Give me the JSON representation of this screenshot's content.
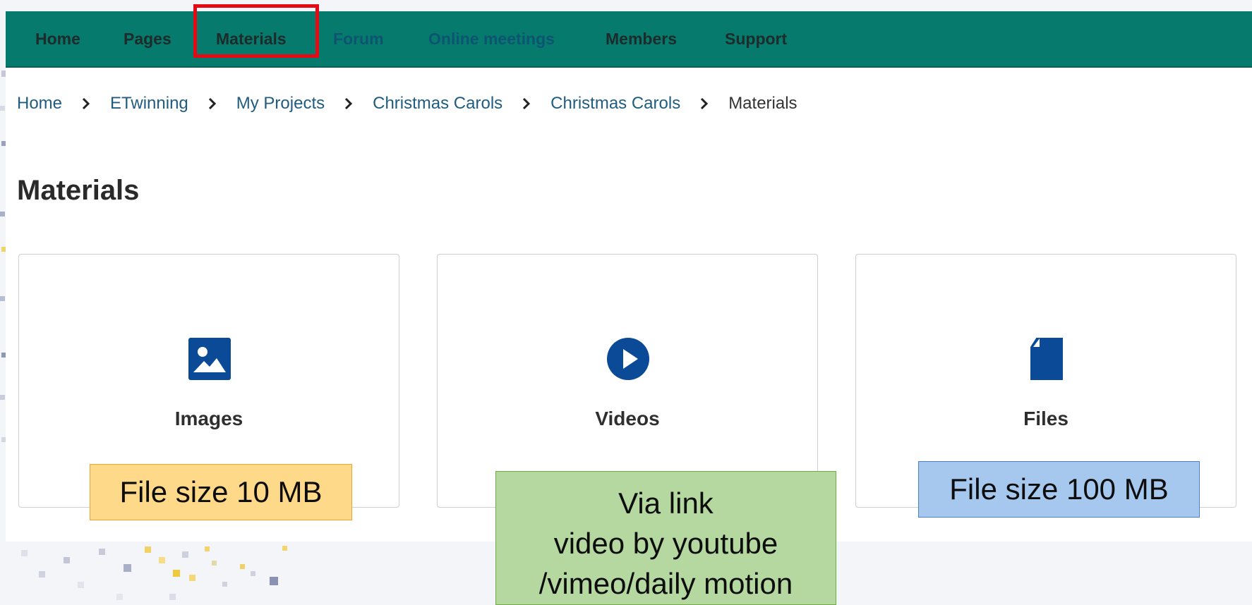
{
  "nav": {
    "items": [
      {
        "label": "Home"
      },
      {
        "label": "Pages"
      },
      {
        "label": "Materials"
      },
      {
        "label": "Forum"
      },
      {
        "label": "Online meetings"
      },
      {
        "label": "Members"
      },
      {
        "label": "Support"
      }
    ],
    "highlighted": "Materials"
  },
  "breadcrumb": [
    "Home",
    "ETwinning",
    "My Projects",
    "Christmas Carols",
    "Christmas Carols",
    "Materials"
  ],
  "page_title": "Materials",
  "cards": [
    {
      "label": "Images",
      "icon": "image-icon"
    },
    {
      "label": "Videos",
      "icon": "play-circle-icon"
    },
    {
      "label": "Files",
      "icon": "file-icon"
    }
  ],
  "notes": {
    "images": "File size 10 MB",
    "videos": [
      "Via link",
      "video by youtube",
      "/vimeo/daily motion"
    ],
    "files": "File size 100 MB"
  },
  "colors": {
    "nav_bg": "#067a6d",
    "icon_blue": "#0b4a96",
    "highlight_red": "#e50914",
    "note_yellow": "#ffd98a",
    "note_green": "#b4d8a0",
    "note_blue": "#a6c8ef"
  }
}
